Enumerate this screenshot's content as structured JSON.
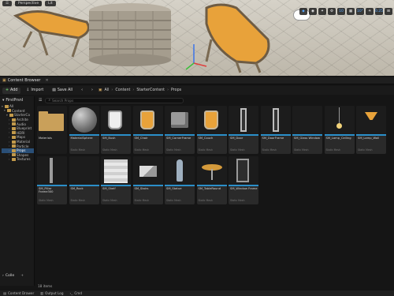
{
  "viewport": {
    "perspective_label": "Perspective",
    "lit_label": "Lit",
    "right_buttons": [
      "◆",
      "◉",
      "✦",
      "⚙",
      "10",
      "▦",
      "10°",
      "☀",
      "0.25",
      "⊞"
    ]
  },
  "tab": {
    "label": "Content Browser"
  },
  "toolbar": {
    "add_label": "Add",
    "import_label": "Import",
    "save_all_label": "Save All",
    "breadcrumb": [
      "All",
      "Content",
      "StarterContent",
      "Props"
    ]
  },
  "sources": {
    "header": "FirstPrsnI",
    "items": [
      {
        "label": "All",
        "depth": 0
      },
      {
        "label": "Content",
        "depth": 1
      },
      {
        "label": "StarterCo",
        "depth": 2
      },
      {
        "label": "Archite",
        "depth": 3
      },
      {
        "label": "Audio",
        "depth": 3
      },
      {
        "label": "Blueprint",
        "depth": 3
      },
      {
        "label": "HDRI",
        "depth": 3
      },
      {
        "label": "Maps",
        "depth": 3
      },
      {
        "label": "Material",
        "depth": 3
      },
      {
        "label": "Particle",
        "depth": 3
      },
      {
        "label": "Props",
        "depth": 3,
        "selected": true
      },
      {
        "label": "Shapes",
        "depth": 3
      },
      {
        "label": "Textures",
        "depth": 3
      }
    ],
    "collections_label": "Colle"
  },
  "filter": {
    "search_placeholder": "Search Props"
  },
  "assets": [
    {
      "name": "Materials",
      "type": "",
      "thumb": "folder"
    },
    {
      "name": "MaterialSphere",
      "type": "Static Mesh",
      "thumb": "sphere"
    },
    {
      "name": "SM_Bush",
      "type": "Static Mesh",
      "thumb": "chair-white"
    },
    {
      "name": "SM_Chair",
      "type": "Static Mesh",
      "thumb": "chair"
    },
    {
      "name": "SM_CornerFrame",
      "type": "Static Mesh",
      "thumb": "box"
    },
    {
      "name": "SM_Couch",
      "type": "Static Mesh",
      "thumb": "chair"
    },
    {
      "name": "SM_Door",
      "type": "Static Mesh",
      "thumb": "frame"
    },
    {
      "name": "SM_DoorFrame",
      "type": "Static Mesh",
      "thumb": "frame"
    },
    {
      "name": "SM_Glass Window",
      "type": "Static Mesh",
      "thumb": "none"
    },
    {
      "name": "SM_Lamp_Ceiling",
      "type": "Static Mesh",
      "thumb": "lamp-ceiling"
    },
    {
      "name": "SM_Lamp_Wall",
      "type": "Static Mesh",
      "thumb": "lamp-wall"
    },
    {
      "name": "SM_Pillar Frame300",
      "type": "Static Mesh",
      "thumb": "pillar"
    },
    {
      "name": "SM_Rock",
      "type": "Static Mesh",
      "thumb": "none"
    },
    {
      "name": "SM_Shelf",
      "type": "Static Mesh",
      "thumb": "shelf"
    },
    {
      "name": "SM_Stairs",
      "type": "Static Mesh",
      "thumb": "stairs"
    },
    {
      "name": "SM_Statue",
      "type": "Static Mesh",
      "thumb": "statue"
    },
    {
      "name": "SM_TableRound",
      "type": "Static Mesh",
      "thumb": "table"
    },
    {
      "name": "SM_Window Frame",
      "type": "Static Mesh",
      "thumb": "window"
    }
  ],
  "status": {
    "item_count": "18 items"
  },
  "bottom_bar": [
    "Content Drawer",
    "Output Log",
    "Cmd"
  ],
  "colors": {
    "accent_strip": "#2b8fc9",
    "folder": "#c9a05a",
    "selection": "#2a4f77"
  }
}
